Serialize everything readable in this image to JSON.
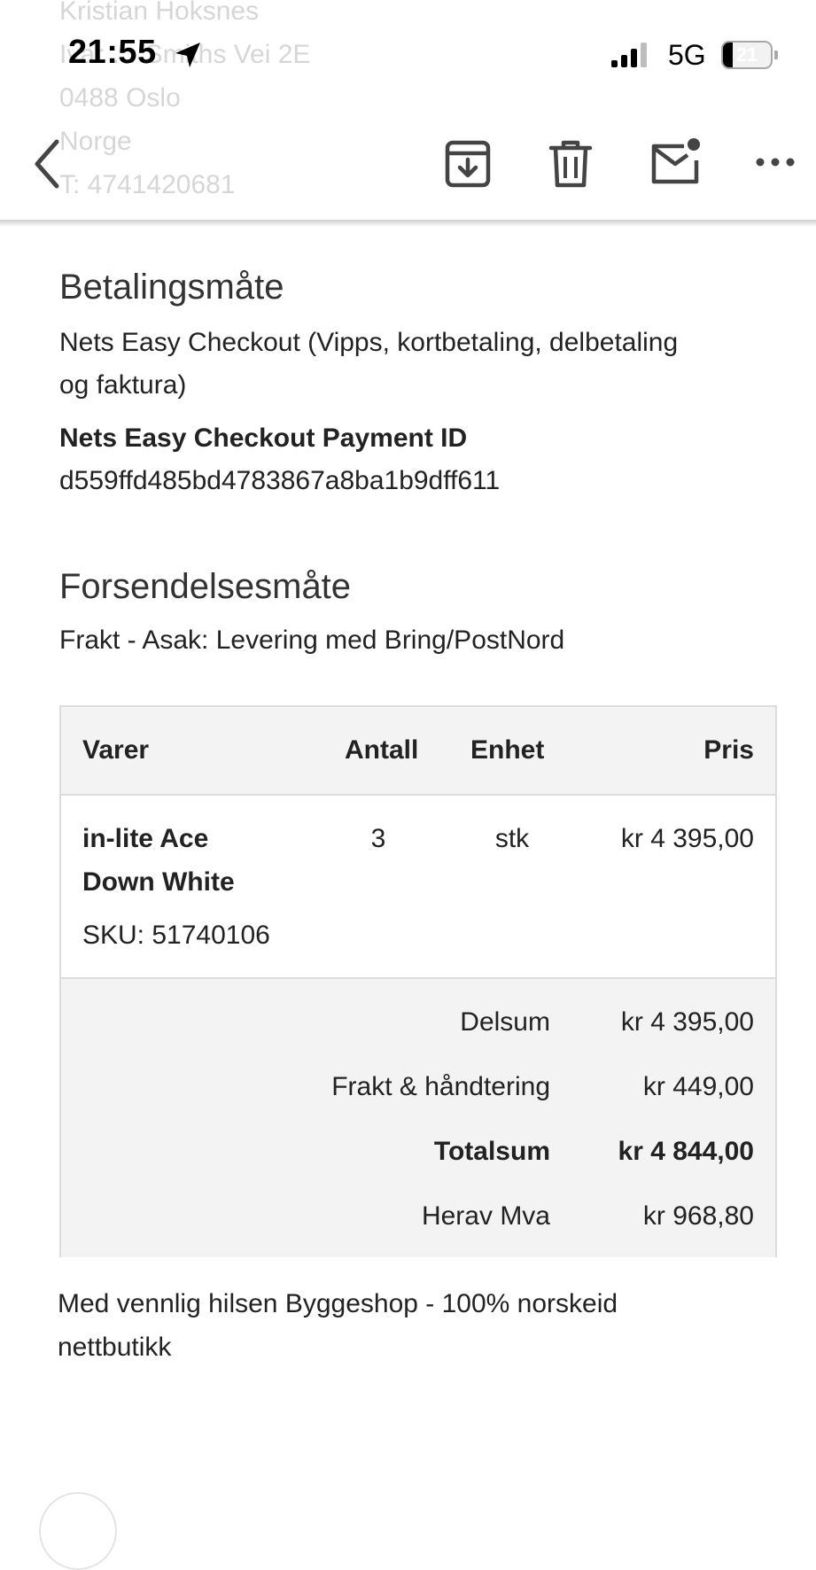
{
  "status_bar": {
    "time": "21:55",
    "network": "5G",
    "battery_percent": "21",
    "battery_level": 0.21
  },
  "background_address": {
    "lines": [
      "Kristian Hoksnes",
      "Ivar … Smiths Vei 2E",
      "0488 Oslo",
      "Norge",
      "T: 4741420681"
    ]
  },
  "toolbar": {
    "icons": [
      "back-chevron-icon",
      "archive-icon",
      "trash-icon",
      "mail-unread-icon",
      "more-icon"
    ]
  },
  "payment": {
    "heading": "Betalingsmåte",
    "method_line1": "Nets Easy Checkout (Vipps, kortbetaling, delbetaling",
    "method_line2": "og faktura)",
    "id_label": "Nets Easy Checkout Payment ID",
    "id_value": "d559ffd485bd4783867a8ba1b9dff611"
  },
  "shipping": {
    "heading": "Forsendelsesmåte",
    "method": "Frakt - Asak: Levering med Bring/PostNord"
  },
  "order_table": {
    "headers": {
      "item": "Varer",
      "qty": "Antall",
      "unit": "Enhet",
      "price": "Pris"
    },
    "rows": [
      {
        "name_line1": "in-lite Ace",
        "name_line2": "Down White",
        "sku": "SKU: 51740106",
        "qty": "3",
        "unit": "stk",
        "price": "kr 4 395,00"
      }
    ],
    "totals": [
      {
        "label": "Delsum",
        "value": "kr 4 395,00"
      },
      {
        "label": "Frakt & håndtering",
        "value": "kr 449,00"
      },
      {
        "label": "Totalsum",
        "value": "kr 4 844,00"
      },
      {
        "label": "Herav Mva",
        "value": "kr 968,80"
      }
    ]
  },
  "closing": {
    "line1": "Med vennlig hilsen Byggeshop - 100% norskeid",
    "line2": "nettbutikk"
  },
  "colors": {
    "text": "#222222",
    "border": "#dcdcdc",
    "table_shade": "#f3f3f3",
    "icon": "#444444"
  }
}
